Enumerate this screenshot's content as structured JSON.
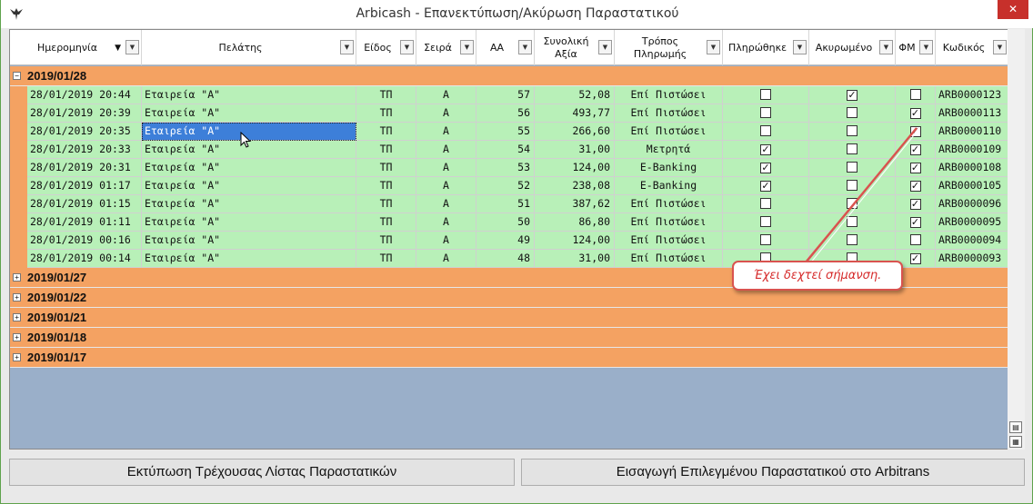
{
  "window": {
    "title": "Arbicash - Επανεκτύπωση/Ακύρωση Παραστατικού",
    "close_label": "✕",
    "app_icon": "eagle-icon"
  },
  "columns": [
    {
      "label": "Ημερομηνία",
      "sort": "desc"
    },
    {
      "label": "Πελάτης"
    },
    {
      "label": "Είδος"
    },
    {
      "label": "Σειρά"
    },
    {
      "label": "ΑΑ"
    },
    {
      "label": "Συνολική\nΑξία"
    },
    {
      "label": "Τρόπος\nΠληρωμής"
    },
    {
      "label": "Πληρώθηκε"
    },
    {
      "label": "Ακυρωμένο"
    },
    {
      "label": "ΦΜ"
    },
    {
      "label": "Κωδικός"
    }
  ],
  "groups": [
    {
      "date": "2019/01/28",
      "expanded": true,
      "toggle": "−",
      "rows": [
        {
          "date": "28/01/2019 20:44",
          "customer": "Εταιρεία \"Α\"",
          "type": "ΤΠ",
          "series": "Α",
          "aa": "57",
          "total": "52,08",
          "payment": "Επί Πιστώσει",
          "paid": false,
          "cancelled": true,
          "fm": false,
          "code": "ARB0000123"
        },
        {
          "date": "28/01/2019 20:39",
          "customer": "Εταιρεία \"Α\"",
          "type": "ΤΠ",
          "series": "Α",
          "aa": "56",
          "total": "493,77",
          "payment": "Επί Πιστώσει",
          "paid": false,
          "cancelled": false,
          "fm": true,
          "code": "ARB0000113"
        },
        {
          "date": "28/01/2019 20:35",
          "customer": "Εταιρεία \"Α\"",
          "type": "ΤΠ",
          "series": "Α",
          "aa": "55",
          "total": "266,60",
          "payment": "Επί Πιστώσει",
          "paid": false,
          "cancelled": false,
          "fm": true,
          "code": "ARB0000110",
          "selected_cell": "customer"
        },
        {
          "date": "28/01/2019 20:33",
          "customer": "Εταιρεία \"Α\"",
          "type": "ΤΠ",
          "series": "Α",
          "aa": "54",
          "total": "31,00",
          "payment": "Μετρητά",
          "paid": true,
          "cancelled": false,
          "fm": true,
          "code": "ARB0000109"
        },
        {
          "date": "28/01/2019 20:31",
          "customer": "Εταιρεία \"Α\"",
          "type": "ΤΠ",
          "series": "Α",
          "aa": "53",
          "total": "124,00",
          "payment": "E-Banking",
          "paid": true,
          "cancelled": false,
          "fm": true,
          "code": "ARB0000108"
        },
        {
          "date": "28/01/2019 01:17",
          "customer": "Εταιρεία \"Α\"",
          "type": "ΤΠ",
          "series": "Α",
          "aa": "52",
          "total": "238,08",
          "payment": "E-Banking",
          "paid": true,
          "cancelled": false,
          "fm": true,
          "code": "ARB0000105"
        },
        {
          "date": "28/01/2019 01:15",
          "customer": "Εταιρεία \"Α\"",
          "type": "ΤΠ",
          "series": "Α",
          "aa": "51",
          "total": "387,62",
          "payment": "Επί Πιστώσει",
          "paid": false,
          "cancelled": false,
          "fm": true,
          "code": "ARB0000096"
        },
        {
          "date": "28/01/2019 01:11",
          "customer": "Εταιρεία \"Α\"",
          "type": "ΤΠ",
          "series": "Α",
          "aa": "50",
          "total": "86,80",
          "payment": "Επί Πιστώσει",
          "paid": false,
          "cancelled": false,
          "fm": true,
          "code": "ARB0000095"
        },
        {
          "date": "28/01/2019 00:16",
          "customer": "Εταιρεία \"Α\"",
          "type": "ΤΠ",
          "series": "Α",
          "aa": "49",
          "total": "124,00",
          "payment": "Επί Πιστώσει",
          "paid": false,
          "cancelled": false,
          "fm": false,
          "code": "ARB0000094"
        },
        {
          "date": "28/01/2019 00:14",
          "customer": "Εταιρεία \"Α\"",
          "type": "ΤΠ",
          "series": "Α",
          "aa": "48",
          "total": "31,00",
          "payment": "Επί Πιστώσει",
          "paid": false,
          "cancelled": false,
          "fm": true,
          "code": "ARB0000093"
        }
      ]
    },
    {
      "date": "2019/01/27",
      "expanded": false,
      "toggle": "+",
      "rows": []
    },
    {
      "date": "2019/01/22",
      "expanded": false,
      "toggle": "+",
      "rows": []
    },
    {
      "date": "2019/01/21",
      "expanded": false,
      "toggle": "+",
      "rows": []
    },
    {
      "date": "2019/01/18",
      "expanded": false,
      "toggle": "+",
      "rows": []
    },
    {
      "date": "2019/01/17",
      "expanded": false,
      "toggle": "+",
      "rows": []
    }
  ],
  "callout": {
    "text": "Έχει δεχτεί σήμανση.",
    "color": "#d62b2b"
  },
  "buttons": {
    "print_list": "Εκτύπωση Τρέχουσας Λίστας Παραστατικών",
    "import_arbitrans": "Εισαγωγή Επιλεγμένου Παραστατικού στο Arbitrans"
  },
  "colors": {
    "group_bg": "#f4a262",
    "row_bg": "#b8f0b8",
    "selection": "#3d7fd9",
    "empty_bg": "#9aafc9",
    "accent": "#c7302b"
  }
}
